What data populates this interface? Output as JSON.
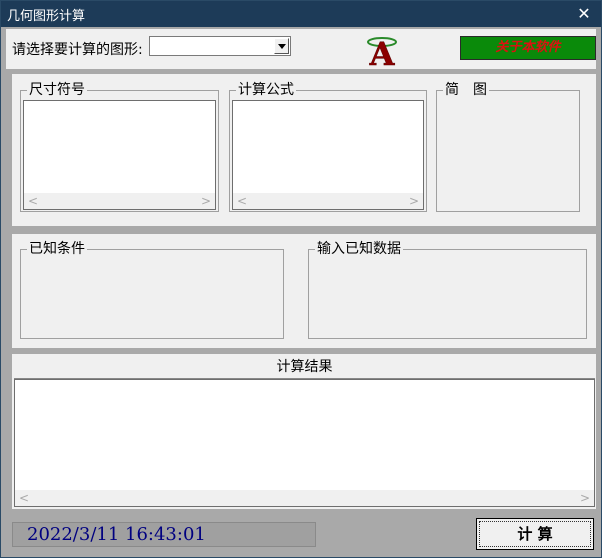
{
  "window": {
    "title": "几何图形计算",
    "close_glyph": "✕"
  },
  "header": {
    "select_label": "请选择要计算的图形:",
    "shape_select_value": "",
    "about_button": "关于本软件",
    "logo_letter": "A"
  },
  "groups": {
    "dimension_symbols": "尺寸符号",
    "formula": "计算公式",
    "diagram": "简　图",
    "known_conditions": "已知条件",
    "input_known_data": "输入已知数据"
  },
  "result": {
    "header": "计算结果",
    "content": ""
  },
  "footer": {
    "datetime": "2022/3/11  16:43:01",
    "calc_button": "计 算"
  },
  "colors": {
    "titlebar": "#1d3b58",
    "about_bg": "#0a8a0a",
    "about_text": "#dd1111",
    "datetime_text": "#000080"
  }
}
